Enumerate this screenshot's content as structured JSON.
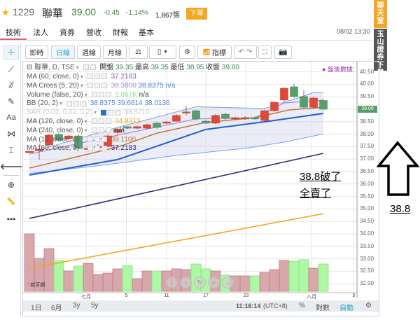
{
  "header": {
    "code": "1229",
    "name": "聯華",
    "price": "39.00",
    "change": "-0.45",
    "change_pct": "-1.14%",
    "volume": "1,867張",
    "order_button": "下單"
  },
  "tabs": [
    {
      "label": "技術"
    },
    {
      "label": "法人"
    },
    {
      "label": "資券"
    },
    {
      "label": "營收"
    },
    {
      "label": "財報"
    },
    {
      "label": "基本"
    }
  ],
  "datetime": "08/02 13:30",
  "side_tabs": {
    "chat": "聊天室",
    "broker": "玉山證券下單"
  },
  "toolbar": {
    "realtime": "即時",
    "daily": "日線",
    "weekly": "週線",
    "monthly": "月線",
    "indicators": "指標"
  },
  "legend": {
    "main": {
      "title": "聯華, D, TSE",
      "open_label": "開盤",
      "open": "39.35",
      "high_label": "最高",
      "high": "39.35",
      "low_label": "最低",
      "low": "38.95",
      "close_label": "收盤",
      "close": "39.00"
    },
    "rows": [
      {
        "label": "MA (60, close, 0)",
        "values": "37.2183",
        "color": "#7b5ea8"
      },
      {
        "label": "MA Cross (5, 20)",
        "values": "39.3800",
        "values2": "38.8375 n/a",
        "color": "#a58fd6"
      },
      {
        "label": "Volume (false, 20)",
        "values": "1.867K",
        "values2": "n/a",
        "color": "#7fe67f"
      },
      {
        "label": "BB (20, 2)",
        "values": "38.8375 39.6614 38.0136",
        "color": "#4f7fe0"
      },
      {
        "label": "SAR (0.02, 0.02, 0.2)",
        "values": "38.8710",
        "color": "#cccccc"
      },
      {
        "label": "MA (120, close, 0)",
        "values": "34.8313",
        "color": "#f5a623"
      },
      {
        "label": "MA (240, close, 0)",
        "values": "n/a",
        "color": "#333333"
      },
      {
        "label": "MA (10, close, 0)",
        "values": "39.1100",
        "color": "#b87333"
      },
      {
        "label": "MA (60, close, 0)",
        "values": "37.2183",
        "color": "#3a2d7a"
      }
    ]
  },
  "after_hours": "盤後數據",
  "current_price_tag": "39.00",
  "axis_ticks": [
    "40.50",
    "40.00",
    "39.50",
    "39.00",
    "38.50",
    "38.00",
    "37.50",
    "37.00",
    "36.50",
    "36.00",
    "35.50",
    "35.00",
    "34.50",
    "34.00",
    "33.50",
    "33.00",
    "32.50",
    "32.00"
  ],
  "date_labels": [
    {
      "t": "七月",
      "i": 5.8
    },
    {
      "t": "5",
      "i": 9.9
    },
    {
      "t": "11",
      "i": 14
    },
    {
      "t": "17",
      "i": 18
    },
    {
      "t": "23",
      "i": 22.1
    },
    {
      "t": "八月",
      "i": 28.8
    },
    {
      "t": "5",
      "i": 33.1
    }
  ],
  "bottom_bar": {
    "ranges": [
      "1日",
      "6月",
      "3y",
      "5y"
    ],
    "time": "11:16:14",
    "tz": "(UTC+8)",
    "pct": "%",
    "log": "對數",
    "auto": "自動"
  },
  "logo_text": "新亨網",
  "annotations": {
    "line1": "38.8破了",
    "line2": "全賣了",
    "arrow_label": "38.8"
  },
  "colors": {
    "up": "#e0493a",
    "down": "#5a9e6e",
    "vol_up": "#d8a7ab",
    "vol_down": "#adf7a5",
    "accent": "#f5a623",
    "blue": "#2a9fd6"
  },
  "chart_data": {
    "type": "candlestick",
    "ylim": [
      31.8,
      40.7
    ],
    "candles": [
      [
        37.26,
        37.33,
        37.24,
        37.31
      ],
      [
        37.34,
        37.62,
        36.98,
        37.4
      ],
      [
        37.57,
        38.0,
        37.5,
        37.96
      ],
      [
        37.99,
        38.05,
        37.7,
        37.76
      ],
      [
        37.82,
        37.97,
        37.78,
        37.93
      ],
      [
        37.93,
        37.98,
        37.38,
        37.43
      ],
      [
        37.4,
        37.45,
        37.3,
        37.43
      ],
      [
        37.46,
        37.6,
        37.3,
        37.51
      ],
      [
        37.51,
        37.98,
        37.48,
        37.93
      ],
      [
        38.07,
        38.22,
        38.0,
        38.19
      ],
      [
        38.3,
        38.33,
        38.2,
        38.24
      ],
      [
        38.24,
        38.33,
        38.2,
        38.3
      ],
      [
        38.24,
        38.42,
        38.2,
        38.38
      ],
      [
        38.44,
        38.5,
        38.22,
        38.27
      ],
      [
        38.44,
        38.52,
        38.4,
        38.49
      ],
      [
        38.52,
        38.8,
        38.5,
        38.75
      ],
      [
        38.88,
        39.11,
        38.75,
        38.89
      ],
      [
        38.94,
        38.98,
        38.55,
        38.61
      ],
      [
        38.52,
        38.58,
        38.4,
        38.44
      ],
      [
        38.44,
        38.8,
        38.4,
        38.75
      ],
      [
        38.8,
        38.85,
        38.58,
        38.63
      ],
      [
        38.61,
        38.7,
        38.56,
        38.66
      ],
      [
        38.61,
        38.72,
        38.58,
        38.66
      ],
      [
        38.66,
        38.7,
        38.58,
        38.61
      ],
      [
        38.55,
        38.98,
        38.5,
        38.94
      ],
      [
        38.94,
        39.32,
        38.9,
        39.28
      ],
      [
        39.37,
        39.88,
        39.3,
        39.84
      ],
      [
        39.9,
        40.01,
        39.45,
        39.51
      ],
      [
        39.51,
        39.76,
        39.0,
        39.08
      ],
      [
        39.08,
        39.5,
        39.0,
        39.45
      ],
      [
        39.35,
        39.4,
        38.95,
        39.0
      ]
    ],
    "volume": [
      3928,
      2251,
      2922,
      2108,
      1389,
      1724,
      1916,
      1150,
      1245,
      1533,
      1772,
      862,
      1389,
      1389,
      1389,
      1533,
      1485,
      1868,
      1533,
      1389,
      1102,
      1054,
      1054,
      1054,
      1293,
      1485,
      2108,
      2060,
      2156,
      1581,
      1867
    ],
    "lines": [
      {
        "name": "BB upper",
        "color": "#7d9ee8",
        "w": 1,
        "pts": [
          [
            0,
            37.26
          ],
          [
            9,
            38.27
          ],
          [
            17,
            39.1
          ],
          [
            24,
            39.03
          ],
          [
            27,
            39.4
          ],
          [
            29,
            39.67
          ],
          [
            30,
            39.66
          ]
        ]
      },
      {
        "name": "BB lower",
        "color": "#7d9ee8",
        "w": 1,
        "pts": [
          [
            0,
            36.42
          ],
          [
            8,
            36.78
          ],
          [
            15,
            37.15
          ],
          [
            22,
            37.43
          ],
          [
            26,
            37.68
          ],
          [
            30,
            38.01
          ]
        ]
      },
      {
        "name": "MA5",
        "color": "#a58fd6",
        "w": 1.2,
        "pts": [
          [
            0,
            37.2
          ],
          [
            9,
            37.96
          ],
          [
            17,
            38.61
          ],
          [
            23,
            38.66
          ],
          [
            26,
            39.25
          ],
          [
            30,
            39.37
          ]
        ]
      },
      {
        "name": "MA20",
        "color": "#b87333",
        "w": 1.4,
        "pts": [
          [
            0,
            36.64
          ],
          [
            3,
            36.92
          ],
          [
            9,
            37.48
          ],
          [
            13,
            38.04
          ],
          [
            18,
            38.47
          ],
          [
            23,
            38.66
          ],
          [
            26.5,
            38.97
          ],
          [
            30,
            39.08
          ]
        ]
      },
      {
        "name": "MA60 blue",
        "color": "#1f5fd0",
        "w": 2,
        "pts": [
          [
            0,
            36.36
          ],
          [
            9,
            36.98
          ],
          [
            18,
            38.19
          ],
          [
            25,
            38.55
          ],
          [
            30,
            38.83
          ]
        ]
      },
      {
        "name": "MA navy",
        "color": "#3a2d7a",
        "w": 1.6,
        "pts": [
          [
            0,
            34.62
          ],
          [
            30,
            37.23
          ]
        ]
      },
      {
        "name": "MA120",
        "color": "#f5a623",
        "w": 1.6,
        "pts": [
          [
            0,
            32.62
          ],
          [
            30,
            34.81
          ]
        ]
      }
    ]
  }
}
